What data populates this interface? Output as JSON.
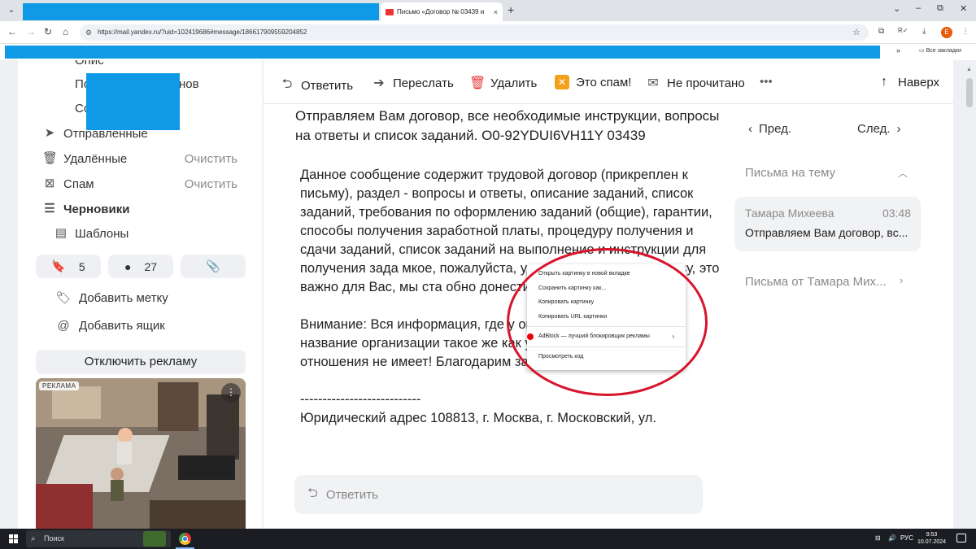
{
  "browser": {
    "tab_title": "Письмо «Договор № 03439 и",
    "tab_close": "×",
    "new_tab": "+",
    "url": "https://mail.yandex.ru/?uid=102419686#message/186617909559204852",
    "profile_initial": "E",
    "bookmarks_all": "Все закладки",
    "window_controls": [
      "⌄",
      "–",
      "⧉",
      "✕"
    ]
  },
  "sidebar": {
    "folders": [
      {
        "label": "Отправленные",
        "icon": "send-icon"
      },
      {
        "label": "Удалённые",
        "icon": "trash-icon",
        "action": "Очистить"
      },
      {
        "label": "Спам",
        "icon": "spam-icon",
        "action": "Очистить"
      },
      {
        "label": "Черновики",
        "icon": "drafts-icon"
      },
      {
        "label": "Шаблоны",
        "icon": "template-icon"
      }
    ],
    "partial_items": [
      "Опис",
      "По",
      "нов",
      "Со"
    ],
    "counters": {
      "bookmarks": "5",
      "unread": "27"
    },
    "add_label": "Добавить метку",
    "add_mailbox": "Добавить ящик",
    "disable_ads": "Отключить рекламу",
    "ad_tag": "РЕКЛАМА"
  },
  "toolbar": {
    "reply": "Ответить",
    "forward": "Переслать",
    "delete": "Удалить",
    "spam": "Это спам!",
    "unread": "Не прочитано",
    "more": "•••",
    "top": "Наверх"
  },
  "message": {
    "subject": "Отправляем Вам договор, все необходимые инструкции, вопросы на ответы и список заданий. O0-92YDUI6VH11Y 03439",
    "p1": "Данное сообщение содержит трудовой договор (прикреплен к письму), раздел - вопросы и ответы, описание заданий, список заданий, требования по оформлению заданий (общие), гарантии, способы получения заработной платы, процедуру получения и сдачи заданий, список заданий на выполнение и инструкции для получения зада                         мкое, пожалуйста, уделите внимание                                   ее слову, это важно для Вас, мы ста                                    обно донести до Вас все подробности",
    "p2": "Внимание: Вся информация, где у                            он отсутствует (даже если название организации такое же как у нас), к нам никакого отношения не имеет! Благодарим за понимание.",
    "separator": "---------------------------",
    "p3": "Юридический адрес 108813, г. Москва, г. Московский, ул.",
    "reply_placeholder": "Ответить"
  },
  "right_panel": {
    "prev": "Пред.",
    "next": "След.",
    "thread_title": "Письма на тему",
    "thread_from": "Тамара Михеева",
    "thread_time": "03:48",
    "thread_snippet": "Отправляем Вам договор, вс...",
    "from_title": "Письма от Тамара Мих..."
  },
  "context_menu": {
    "items": [
      "Открыть картинку в новой вкладке",
      "Сохранить картинку как...",
      "Копировать картинку",
      "Копировать URL картинки"
    ],
    "adblock": "AdBlock — лучший блокировщик рекламы",
    "inspect": "Просмотреть код"
  },
  "taskbar": {
    "search": "Поиск",
    "lang": "РУС",
    "time": "9:53",
    "date": "10.07.2024"
  },
  "colors": {
    "redaction": "#0e9ae6",
    "annotation_circle": "#d8142b",
    "delete_icon": "#e53935",
    "spam_icon": "#f3a31b"
  }
}
